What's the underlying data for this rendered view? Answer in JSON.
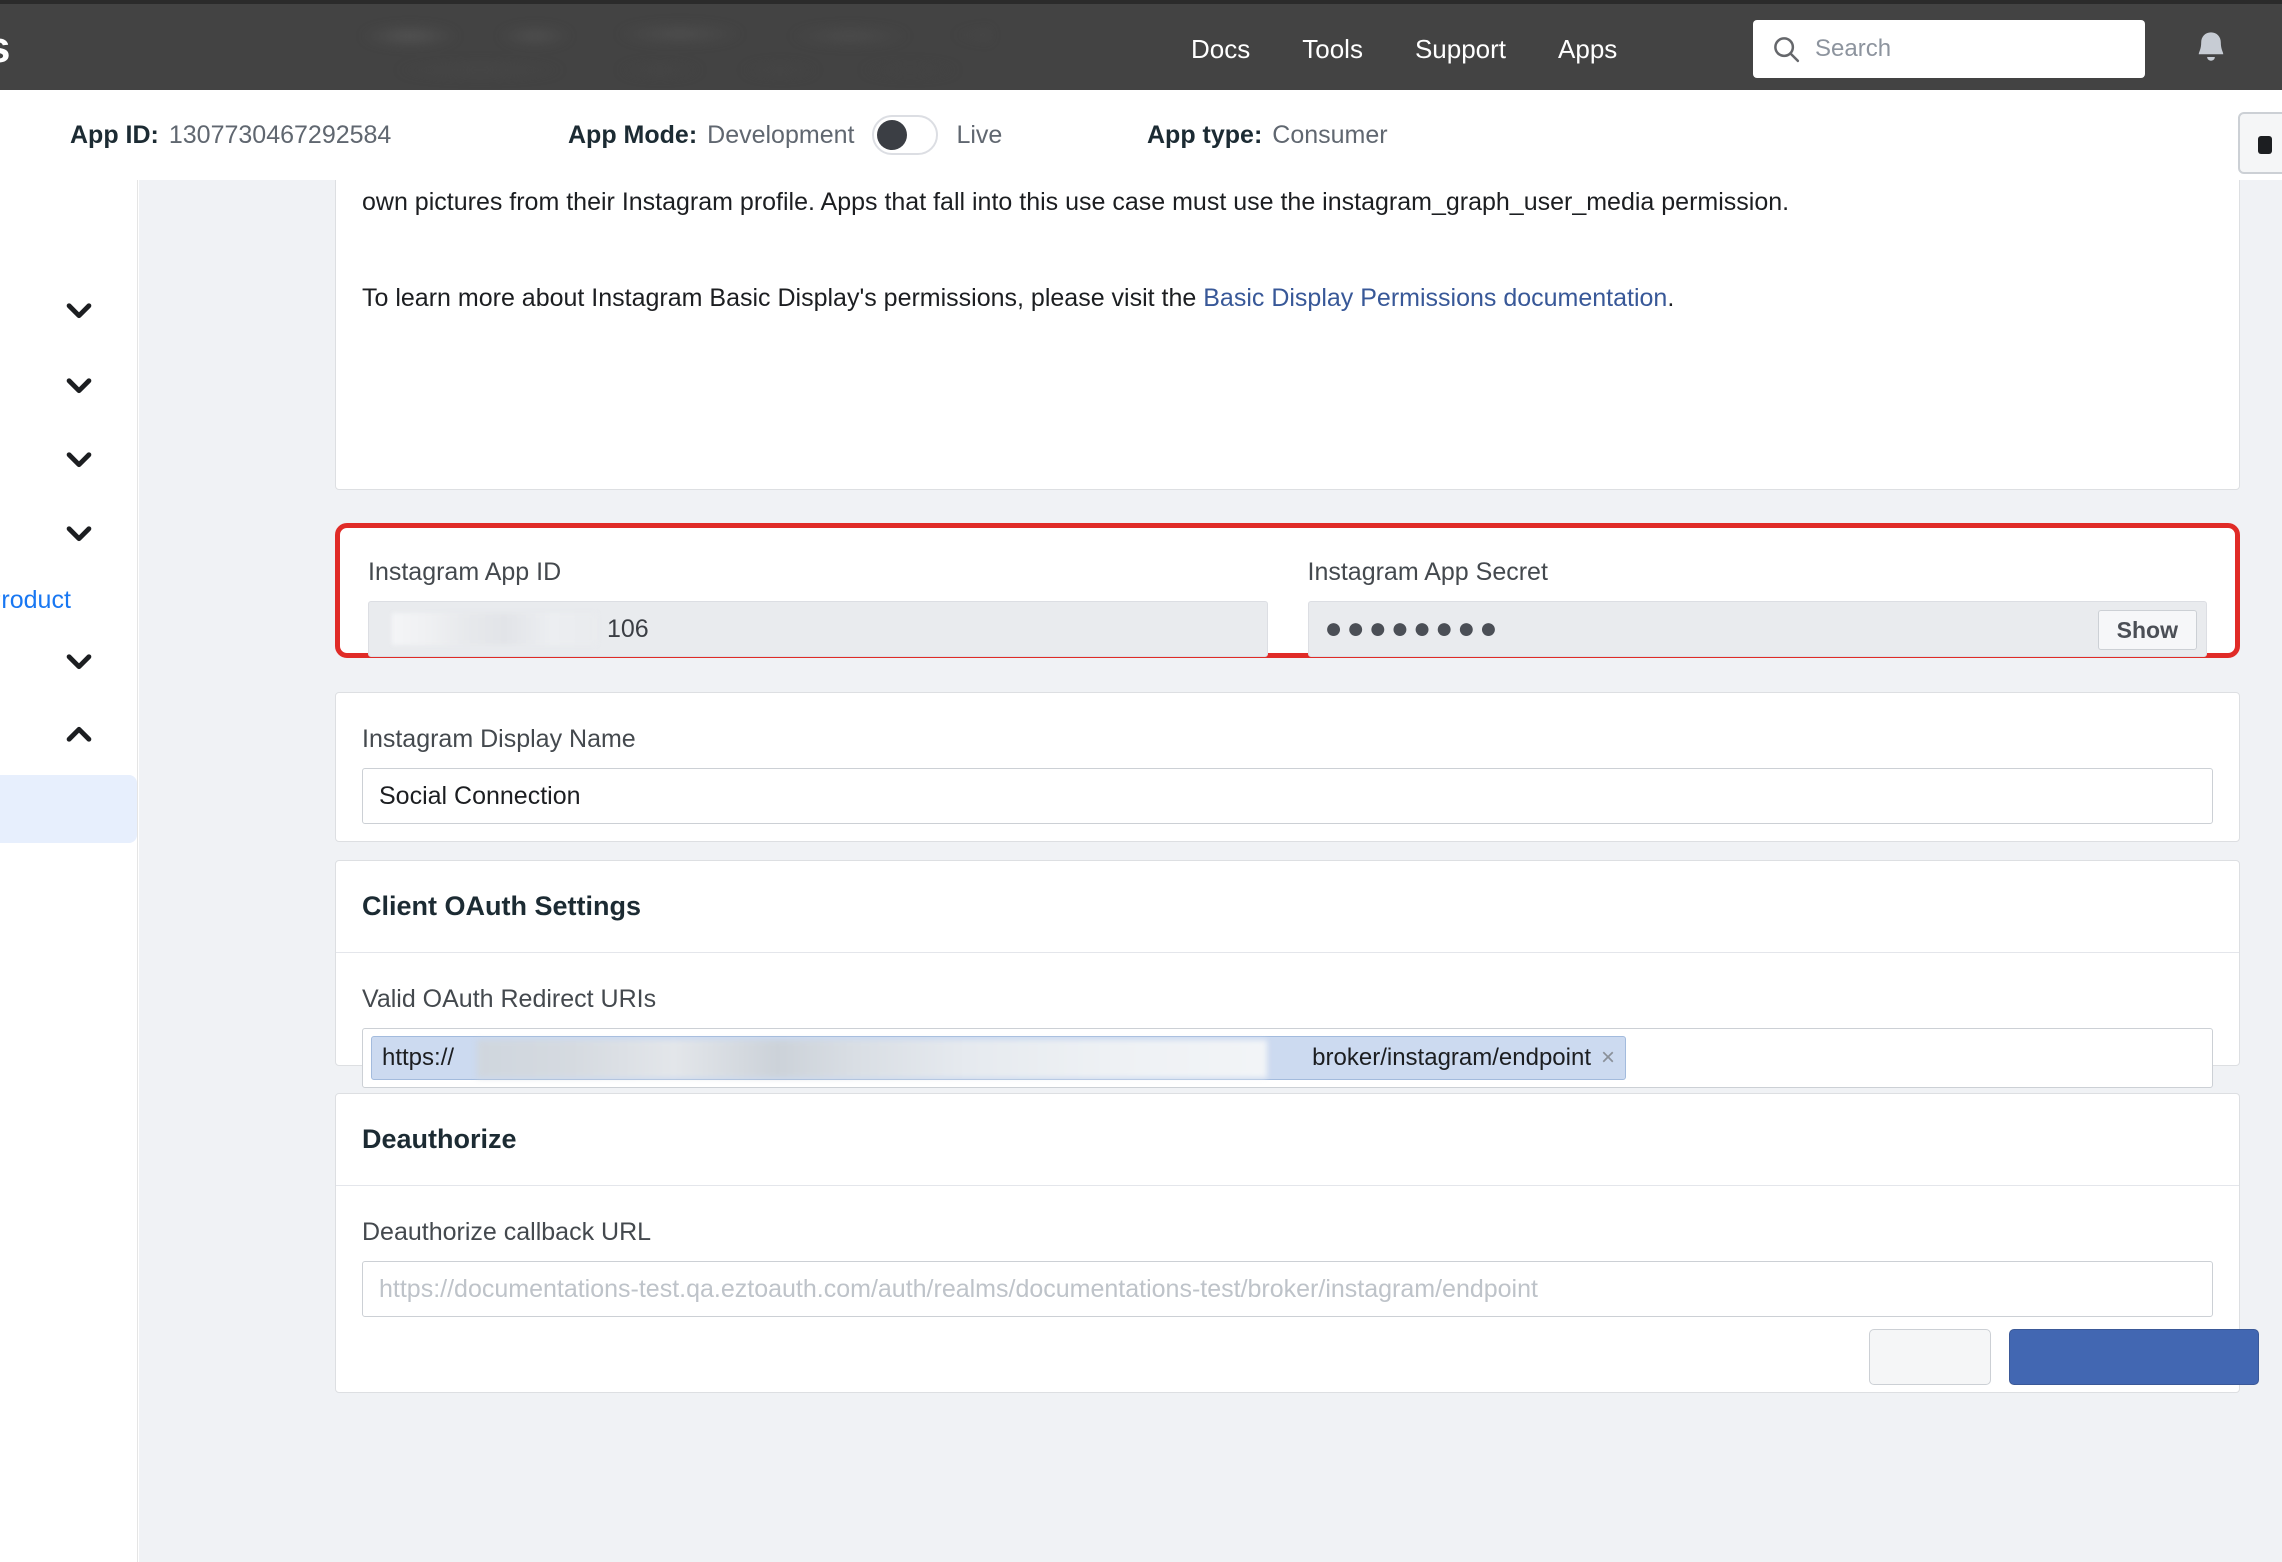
{
  "topbar": {
    "logo_text": "s",
    "nav": [
      {
        "label": "Docs"
      },
      {
        "label": "Tools"
      },
      {
        "label": "Support"
      },
      {
        "label": "Apps"
      }
    ],
    "search": {
      "placeholder": "Search",
      "value": ""
    },
    "icons": {
      "search": "search-icon",
      "bell": "notification-bell-icon"
    },
    "background_color": "#434343"
  },
  "appbar": {
    "app_id_label": "App ID:",
    "app_id_value": "1307730467292584",
    "app_mode_label": "App Mode:",
    "app_mode_left": "Development",
    "app_mode_right": "Live",
    "app_mode_toggle_state": "Development",
    "app_type_label": "App type:",
    "app_type_value": "Consumer"
  },
  "sidebar": {
    "add_product_label": "dd Product",
    "chevron_states": [
      "down",
      "down",
      "down",
      "down",
      "down",
      "up"
    ],
    "active_item_color": "#e7effd"
  },
  "main": {
    "intro": {
      "paragraph_1": "This permission is meant for apps that allow the general public to log in with Instagram to get their own content, for example, an app that allows people to print their own pictures from their Instagram profile. Apps that fall into this use case must use the instagram_graph_user_media permission.",
      "paragraph_2_before_link": "To learn more about Instagram Basic Display's permissions, please visit the ",
      "paragraph_2_link": "Basic Display Permissions documentation",
      "paragraph_2_after_link": "."
    },
    "credentials": {
      "app_id_label": "Instagram App ID",
      "app_id_value": "106",
      "app_secret_label": "Instagram App Secret",
      "app_secret_masked": "●●●●●●●●",
      "show_button_label": "Show",
      "highlight_color": "#e02b27"
    },
    "display_name": {
      "label": "Instagram Display Name",
      "value": "Social Connection"
    },
    "oauth": {
      "section_title": "Client OAuth Settings",
      "redirect_label": "Valid OAuth Redirect URIs",
      "token_lead": "https://",
      "token_tail": "broker/instagram/endpoint",
      "token_remove": "×"
    },
    "deauthorize": {
      "section_title": "Deauthorize",
      "callback_label": "Deauthorize callback URL",
      "callback_placeholder": "https://documentations-test.qa.eztoauth.com/auth/realms/documentations-test/broker/instagram/endpoint",
      "callback_value": "",
      "cancel_label": "",
      "save_label": ""
    }
  }
}
